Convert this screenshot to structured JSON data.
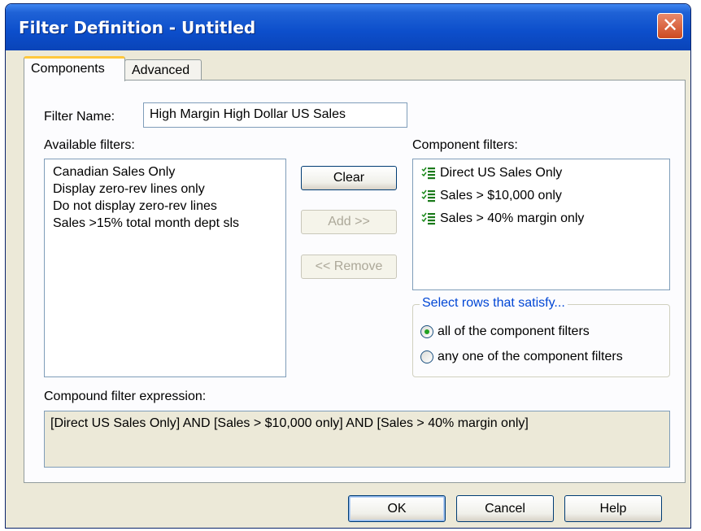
{
  "window": {
    "title": "Filter Definition - Untitled",
    "close_glyph": "✕"
  },
  "tabs": [
    {
      "label": "Components",
      "active": true
    },
    {
      "label": "Advanced",
      "active": false
    }
  ],
  "filter_name": {
    "label": "Filter Name:",
    "value": "High Margin High Dollar US Sales"
  },
  "available": {
    "label": "Available filters:",
    "items": [
      "Canadian Sales Only",
      "Display zero-rev lines only",
      "Do not display zero-rev lines",
      "Sales >15% total month dept sls"
    ]
  },
  "buttons": {
    "clear": "Clear",
    "add": "Add >>",
    "remove": "<< Remove"
  },
  "component": {
    "label": "Component filters:",
    "items": [
      "Direct US Sales Only",
      "Sales > $10,000 only",
      "Sales > 40% margin only"
    ],
    "item_icon": "filter-list-icon"
  },
  "select_rows": {
    "legend": "Select rows that satisfy...",
    "options": [
      "all of the component filters",
      "any one of the component filters"
    ],
    "selected_index": 0
  },
  "expression": {
    "label": "Compound filter expression:",
    "value": "[Direct US Sales Only] AND [Sales > $10,000 only] AND [Sales > 40% margin only]"
  },
  "footer": {
    "ok": "OK",
    "cancel": "Cancel",
    "help": "Help"
  },
  "colors": {
    "titlebar": "#0c4ecb",
    "dialog_bg": "#ece9d8",
    "group_legend": "#0046d5",
    "tab_accent": "#ffc83c"
  }
}
